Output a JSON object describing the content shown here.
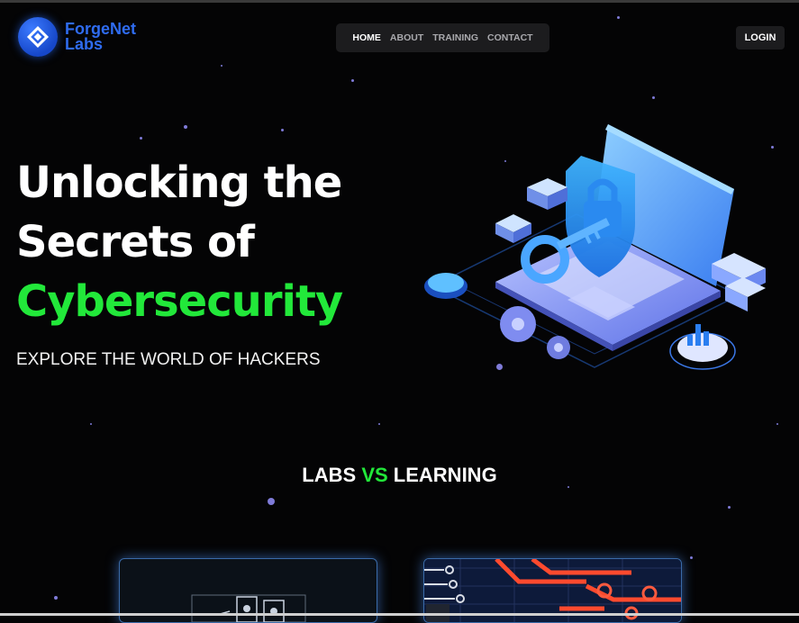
{
  "brand": {
    "line1": "ForgeNet",
    "line2": "Labs"
  },
  "nav": {
    "items": [
      "HOME",
      "ABOUT",
      "TRAINING",
      "CONTACT"
    ],
    "active": "HOME"
  },
  "header": {
    "login_label": "LOGIN"
  },
  "hero": {
    "title_line1": "Unlocking the",
    "title_line2": "Secrets of",
    "title_line3": "Cybersecurity",
    "subtitle": "EXPLORE THE WORLD OF HACKERS"
  },
  "section": {
    "word1": "LABS",
    "word2": "VS",
    "word3": "LEARNING"
  },
  "colors": {
    "accent_green": "#22e83a",
    "brand_blue": "#2f6cf0",
    "background": "#040405"
  }
}
